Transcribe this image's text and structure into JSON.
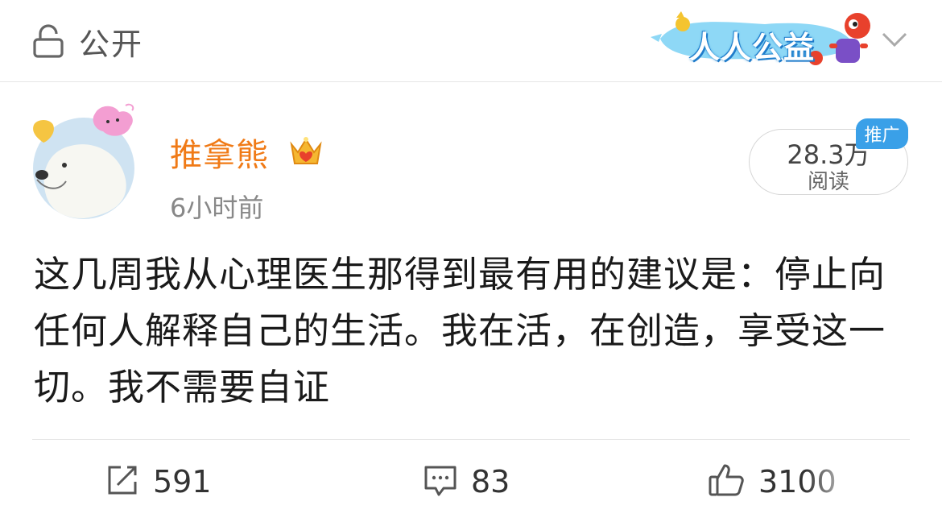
{
  "topbar": {
    "visibility_label": "公开",
    "banner_text": "人人公益"
  },
  "post": {
    "author": "推拿熊",
    "time": "6小时前",
    "reads": {
      "count": "28.3万",
      "unit": "阅读",
      "badge": "推广"
    },
    "text": "这几周我从心理医生那得到最有用的建议是：停止向任何人解释自己的生活。我在活，在创造，享受这一切。我不需要自证"
  },
  "actions": {
    "repost": "591",
    "comment": "83",
    "like": "3100"
  },
  "colors": {
    "author": "#f07a16",
    "accent_blue": "#3aa0e8",
    "muted": "#888888"
  }
}
